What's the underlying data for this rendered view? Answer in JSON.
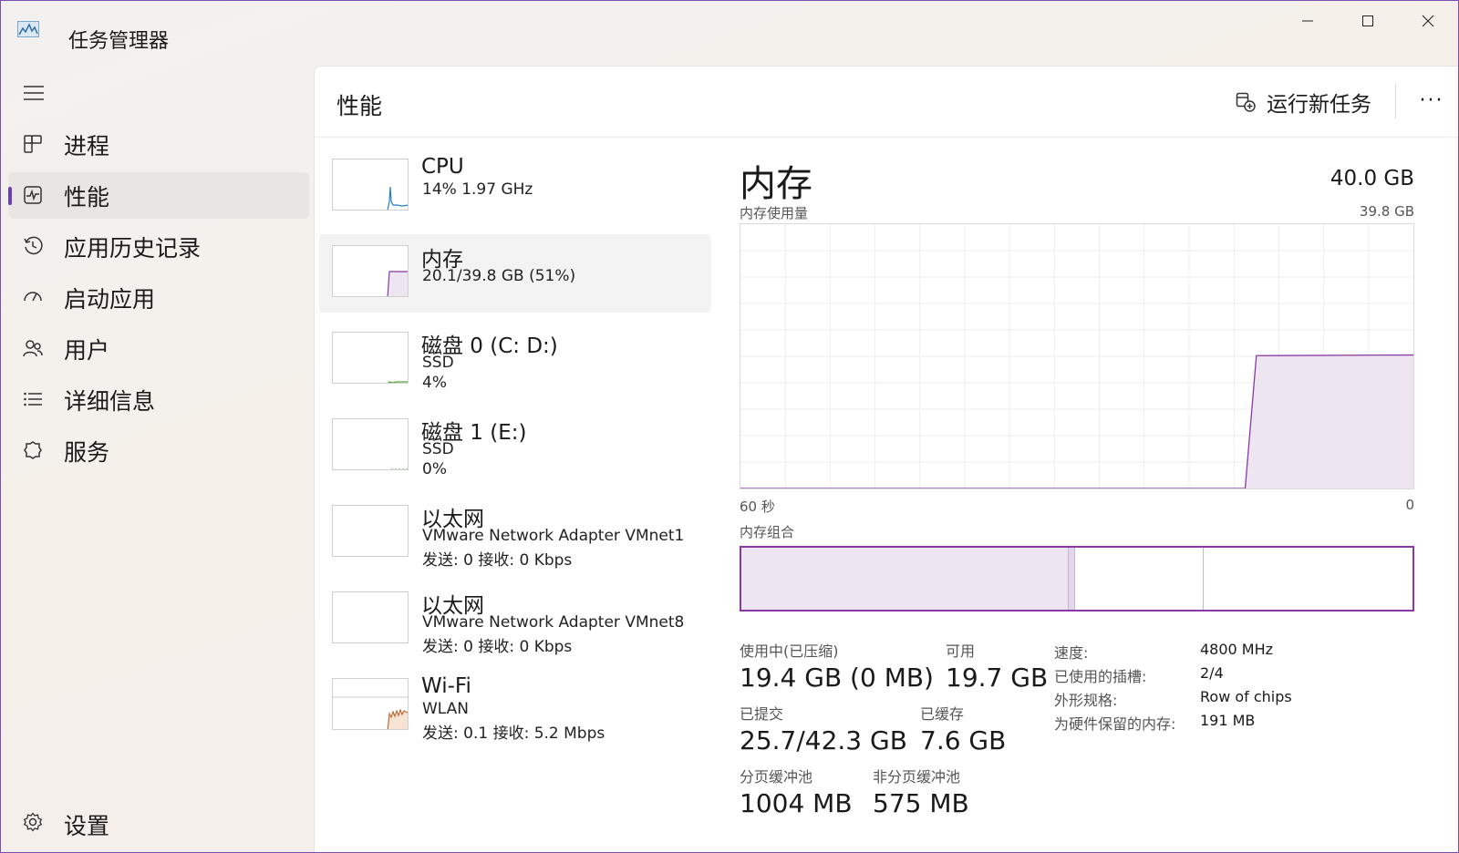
{
  "window": {
    "title": "任务管理器",
    "accent": "#6a3fb5"
  },
  "sidebar": {
    "items": [
      {
        "label": "进程",
        "icon": "processes-icon"
      },
      {
        "label": "性能",
        "icon": "performance-icon",
        "active": true
      },
      {
        "label": "应用历史记录",
        "icon": "history-icon"
      },
      {
        "label": "启动应用",
        "icon": "startup-icon"
      },
      {
        "label": "用户",
        "icon": "users-icon"
      },
      {
        "label": "详细信息",
        "icon": "details-icon"
      },
      {
        "label": "服务",
        "icon": "services-icon"
      }
    ],
    "settings_label": "设置"
  },
  "header": {
    "title": "性能",
    "run_task_label": "运行新任务",
    "more_label": "···"
  },
  "resources": [
    {
      "name": "CPU",
      "sub1": "14% 1.97 GHz",
      "sub2": ""
    },
    {
      "name": "内存",
      "sub1": "20.1/39.8 GB (51%)",
      "sub2": ""
    },
    {
      "name": "磁盘 0 (C: D:)",
      "sub1": "SSD",
      "sub2": "4%"
    },
    {
      "name": "磁盘 1 (E:)",
      "sub1": "SSD",
      "sub2": "0%"
    },
    {
      "name": "以太网",
      "sub1": "VMware Network Adapter VMnet1",
      "sub2": "发送: 0 接收: 0 Kbps"
    },
    {
      "name": "以太网",
      "sub1": "VMware Network Adapter VMnet8",
      "sub2": "发送: 0 接收: 0 Kbps"
    },
    {
      "name": "Wi-Fi",
      "sub1": "WLAN",
      "sub2": "发送: 0.1 接收: 5.2 Mbps"
    }
  ],
  "memory": {
    "title": "内存",
    "capacity": "40.0 GB",
    "usage_label": "内存使用量",
    "usage_max": "39.8 GB",
    "axis_left": "60 秒",
    "axis_right": "0",
    "composition_label": "内存组合",
    "composition": {
      "in_use": 19.4,
      "modified": 0.4,
      "standby": 7.6,
      "free": 12.4
    },
    "stats": {
      "in_use_label": "使用中(已压缩)",
      "in_use_value": "19.4 GB (0 MB)",
      "available_label": "可用",
      "available_value": "19.7 GB",
      "committed_label": "已提交",
      "committed_value": "25.7/42.3 GB",
      "cached_label": "已缓存",
      "cached_value": "7.6 GB",
      "paged_label": "分页缓冲池",
      "paged_value": "1004 MB",
      "nonpaged_label": "非分页缓冲池",
      "nonpaged_value": "575 MB"
    },
    "props": [
      {
        "k": "速度:",
        "v": "4800 MHz"
      },
      {
        "k": "已使用的插槽:",
        "v": "2/4"
      },
      {
        "k": "外形规格:",
        "v": "Row of chips"
      },
      {
        "k": "为硬件保留的内存:",
        "v": "191 MB"
      }
    ]
  },
  "chart_data": {
    "type": "area",
    "ylabel": "内存使用量",
    "ylim": [
      0,
      39.8
    ],
    "xlabel_left": "60 秒",
    "xlabel_right": "0",
    "xlim": [
      60,
      0
    ],
    "series": [
      {
        "x": [
          60,
          15,
          14,
          0
        ],
        "values": [
          0,
          0,
          20.0,
          20.1
        ]
      }
    ]
  },
  "colors": {
    "memory_line": "#8b38a6",
    "memory_fill": "#ede6f1",
    "cpu_line": "#1f7fc4",
    "disk_line": "#4da330",
    "wifi_line": "#b5652b",
    "grid": "#eeeeee"
  }
}
